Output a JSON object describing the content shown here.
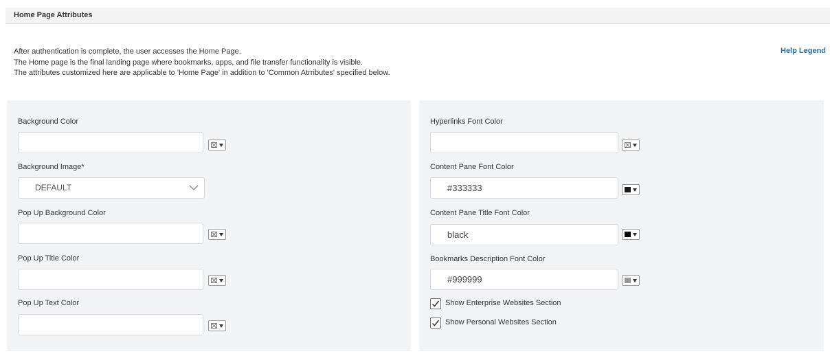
{
  "section": {
    "title": "Home Page Attributes"
  },
  "intro": {
    "line1": "After authentication is complete, the user accesses the Home Page.",
    "line2": "The Home page is the final landing page where bookmarks, apps, and file transfer functionality is visible.",
    "line3": "The attributes customized here are applicable to 'Home Page' in addition to 'Common Atrributes' specified below."
  },
  "help_legend": "Help Legend",
  "left": {
    "background_color": {
      "label": "Background Color",
      "value": ""
    },
    "background_image": {
      "label": "Background Image*",
      "selected": "DEFAULT"
    },
    "popup_background_color": {
      "label": "Pop Up Background Color",
      "value": ""
    },
    "popup_title_color": {
      "label": "Pop Up Title Color",
      "value": ""
    },
    "popup_text_color": {
      "label": "Pop Up Text Color",
      "value": ""
    }
  },
  "right": {
    "hyperlinks_font_color": {
      "label": "Hyperlinks Font Color",
      "value": ""
    },
    "content_pane_font_color": {
      "label": "Content Pane Font Color",
      "value": "#333333",
      "swatch": "#1a1a1a"
    },
    "content_pane_title_font_color": {
      "label": "Content Pane Title Font Color",
      "value": "black",
      "swatch": "#000000"
    },
    "bookmarks_description_font_color": {
      "label": "Bookmarks Description Font Color",
      "value": "#999999",
      "swatch": "#999999"
    },
    "show_enterprise_websites": {
      "label": "Show Enterprise Websites Section",
      "checked": true
    },
    "show_personal_websites": {
      "label": "Show Personal Websites Section",
      "checked": true
    }
  },
  "icons": {
    "picker_arrow": "dropdown-arrow-icon",
    "empty_color": "no-color-icon",
    "select_chevron": "chevron-down-icon",
    "checkmark": "checkmark-icon"
  }
}
